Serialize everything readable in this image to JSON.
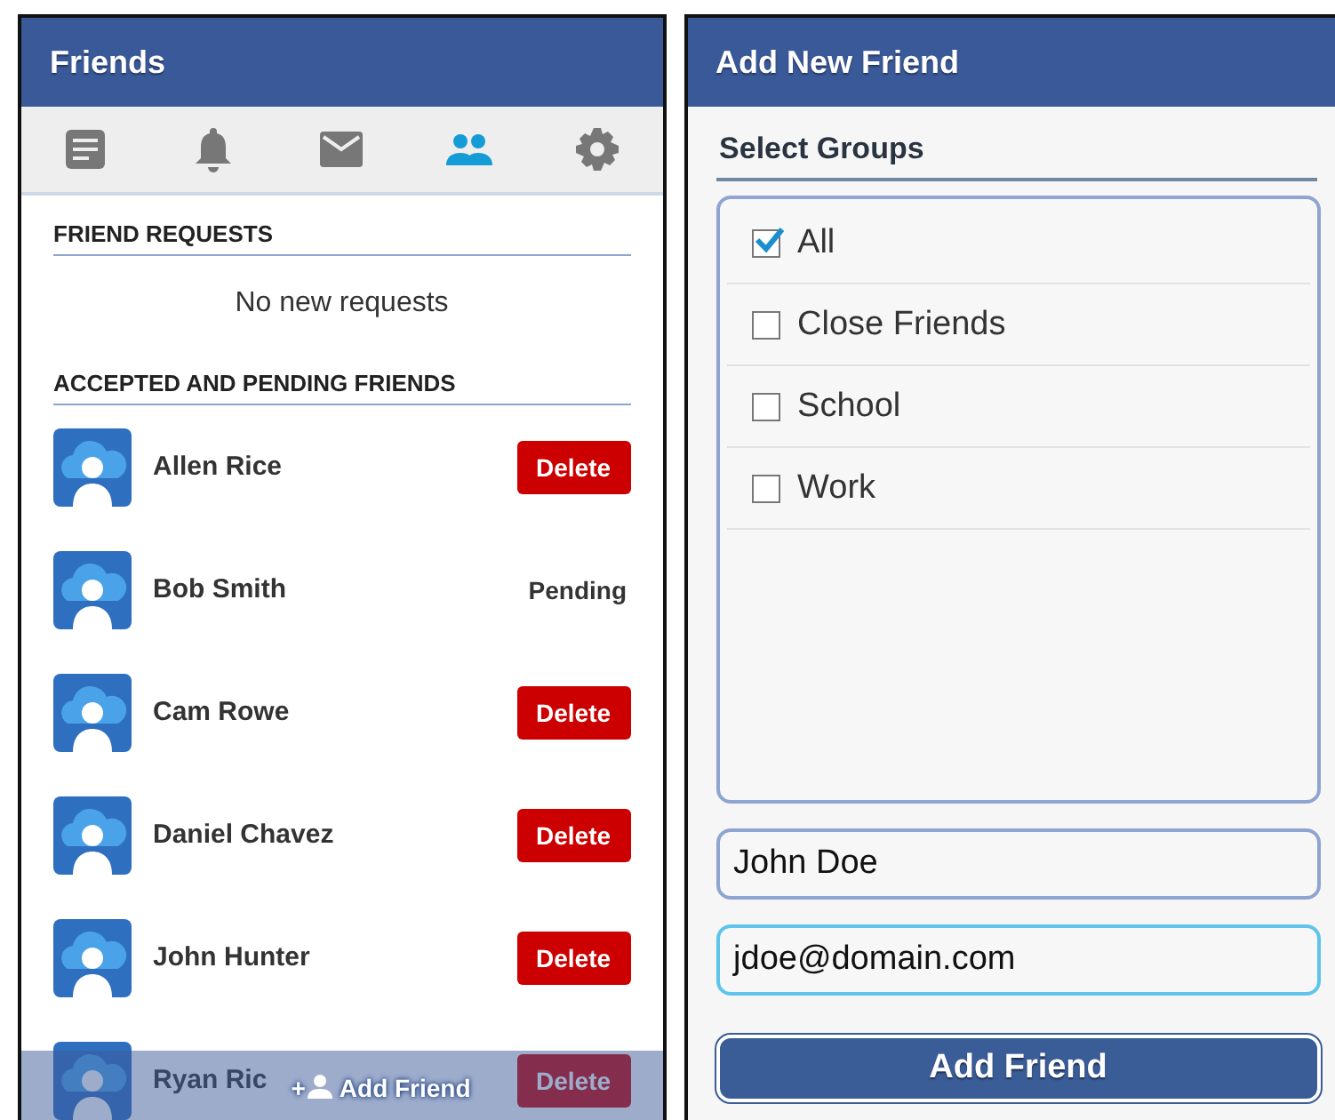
{
  "friends_screen": {
    "title": "Friends",
    "tabs": [
      {
        "kind": "posts",
        "selected": false
      },
      {
        "kind": "notifications",
        "selected": false
      },
      {
        "kind": "messages",
        "selected": false
      },
      {
        "kind": "friends",
        "selected": true
      },
      {
        "kind": "settings",
        "selected": false
      }
    ],
    "requests": {
      "heading": "FRIEND REQUESTS",
      "empty_text": "No new requests"
    },
    "friends": {
      "heading": "ACCEPTED AND PENDING FRIENDS",
      "items": [
        {
          "name": "Allen Rice",
          "kind": "delete",
          "action": "Delete"
        },
        {
          "name": "Bob Smith",
          "kind": "pending",
          "action": "Pending"
        },
        {
          "name": "Cam Rowe",
          "kind": "delete",
          "action": "Delete"
        },
        {
          "name": "Daniel Chavez",
          "kind": "delete",
          "action": "Delete"
        },
        {
          "name": "John Hunter",
          "kind": "delete",
          "action": "Delete"
        },
        {
          "name": "Ryan Ric",
          "kind": "delete",
          "action": "Delete"
        }
      ]
    },
    "add_button": {
      "icon": "+",
      "label": "Add Friend"
    }
  },
  "add_screen": {
    "title": "Add New Friend",
    "groups_heading": "Select Groups",
    "groups": [
      {
        "label": "All",
        "checked": true
      },
      {
        "label": "Close Friends",
        "checked": false
      },
      {
        "label": "School",
        "checked": false
      },
      {
        "label": "Work",
        "checked": false
      }
    ],
    "name_field": {
      "value": "John Doe",
      "focused": false
    },
    "email_field": {
      "value": "jdoe@domain.com",
      "focused": true
    },
    "submit": "Add Friend"
  }
}
